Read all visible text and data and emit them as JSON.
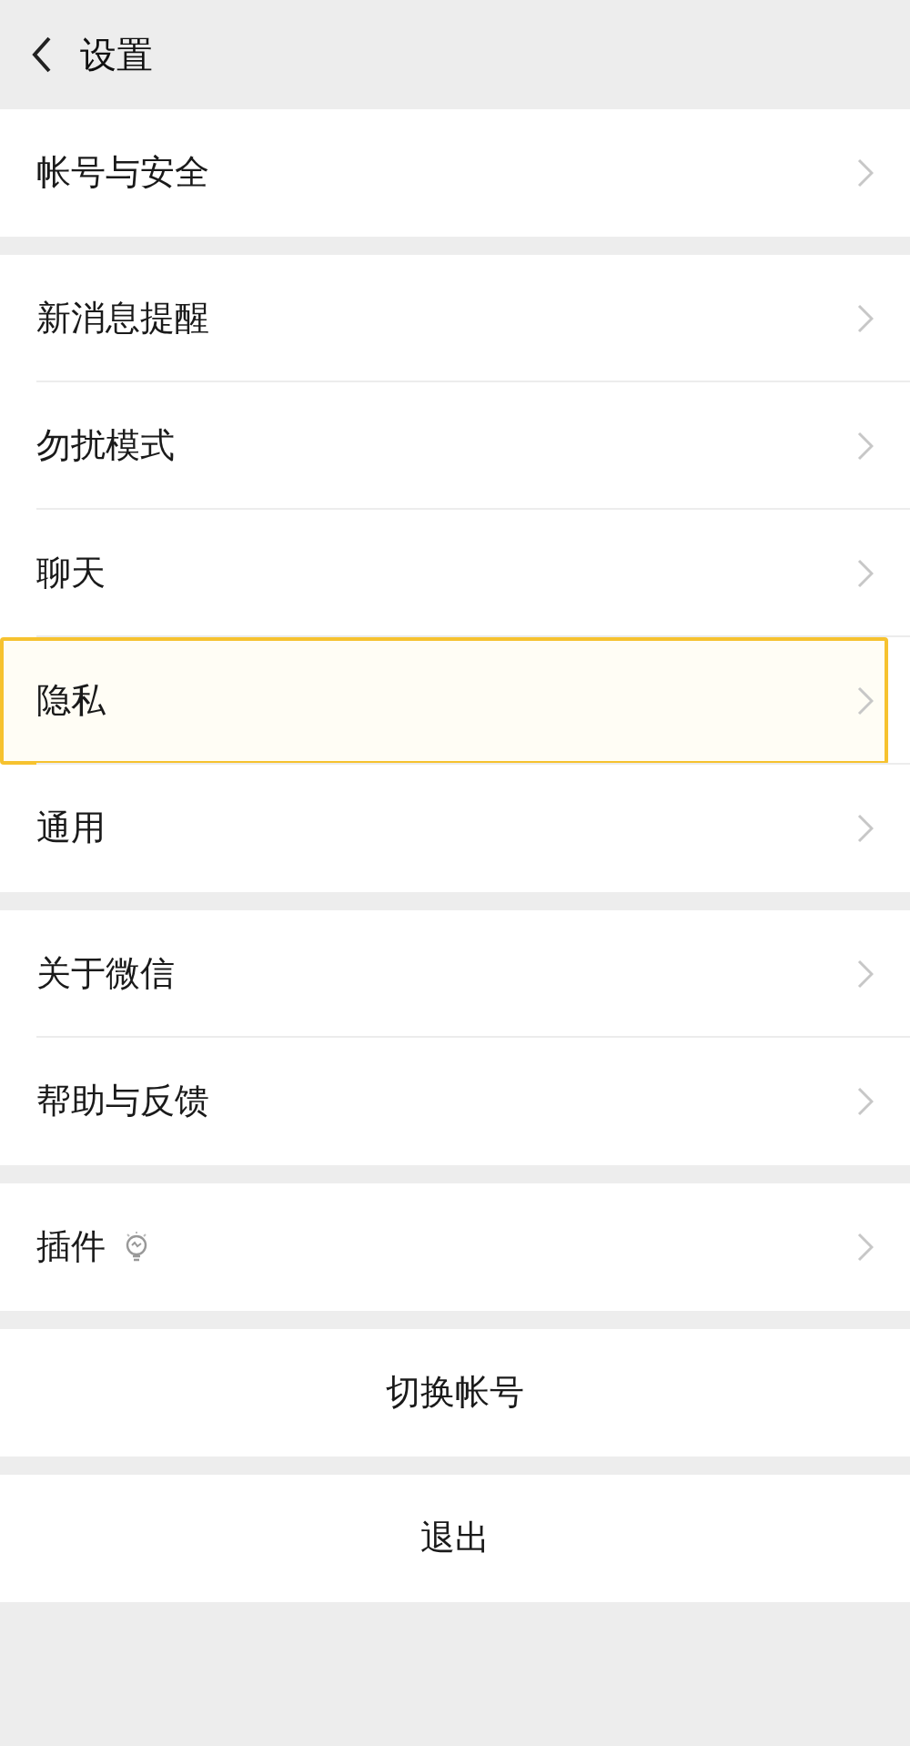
{
  "header": {
    "title": "设置"
  },
  "groups": [
    {
      "items": [
        {
          "kind": "link",
          "label": "帐号与安全",
          "selected": false
        }
      ]
    },
    {
      "items": [
        {
          "kind": "link",
          "label": "新消息提醒",
          "selected": false
        },
        {
          "kind": "link",
          "label": "勿扰模式",
          "selected": false
        },
        {
          "kind": "link",
          "label": "聊天",
          "selected": false
        },
        {
          "kind": "link",
          "label": "隐私",
          "selected": true
        },
        {
          "kind": "link",
          "label": "通用",
          "selected": false
        }
      ]
    },
    {
      "items": [
        {
          "kind": "link",
          "label": "关于微信",
          "selected": false
        },
        {
          "kind": "link",
          "label": "帮助与反馈",
          "selected": false
        }
      ]
    },
    {
      "items": [
        {
          "kind": "plugin",
          "label": "插件",
          "selected": false
        }
      ]
    },
    {
      "items": [
        {
          "kind": "action",
          "label": "切换帐号",
          "selected": false
        }
      ]
    },
    {
      "items": [
        {
          "kind": "action",
          "label": "退出",
          "selected": false
        }
      ]
    }
  ]
}
